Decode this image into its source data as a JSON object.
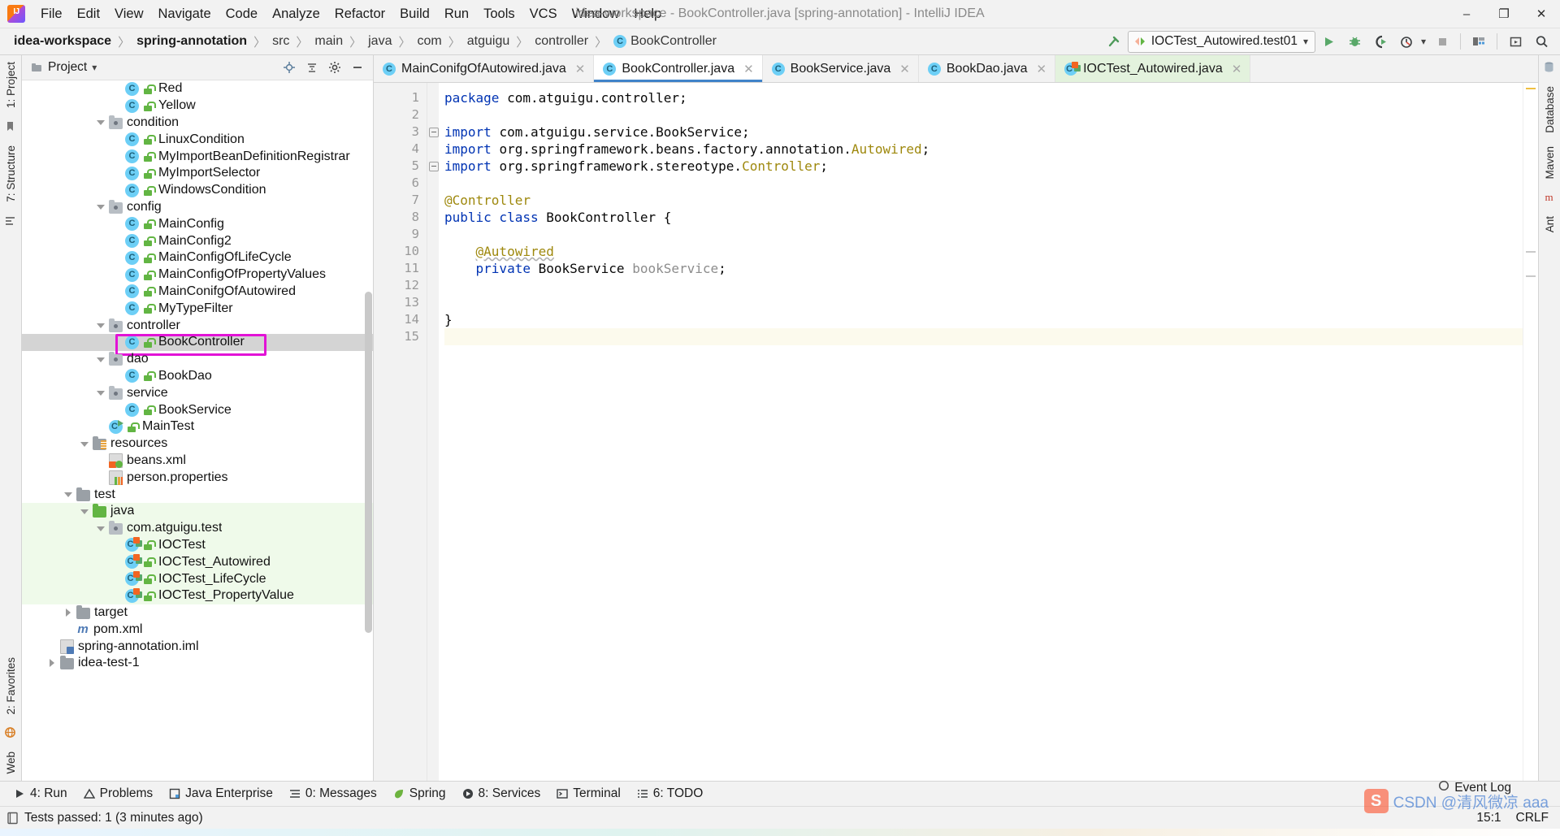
{
  "window": {
    "title": "idea-workspace - BookController.java [spring-annotation] - IntelliJ IDEA",
    "minimize": "–",
    "maximize": "❐",
    "close": "✕"
  },
  "menu": {
    "items": [
      "File",
      "Edit",
      "View",
      "Navigate",
      "Code",
      "Analyze",
      "Refactor",
      "Build",
      "Run",
      "Tools",
      "VCS",
      "Window",
      "Help"
    ]
  },
  "breadcrumb": {
    "items": [
      {
        "label": "idea-workspace",
        "bold": true
      },
      {
        "label": "spring-annotation",
        "bold": true
      },
      {
        "label": "src",
        "bold": false
      },
      {
        "label": "main",
        "bold": false
      },
      {
        "label": "java",
        "bold": false
      },
      {
        "label": "com",
        "bold": false
      },
      {
        "label": "atguigu",
        "bold": false
      },
      {
        "label": "controller",
        "bold": false
      },
      {
        "label": "BookController",
        "bold": false,
        "icon": "class-icon"
      }
    ],
    "separator": "〉"
  },
  "run_toolbar": {
    "config_name": "IOCTest_Autowired.test01",
    "dropdown_caret": "▾",
    "buttons": [
      "run-button",
      "debug-button",
      "run-coverage-button",
      "profile-button",
      "stop-button",
      "build-button",
      "preview-button",
      "search-everywhere-button"
    ],
    "hammer_icon": "build-hammer-icon"
  },
  "project_panel": {
    "title": "Project",
    "title_caret": "▾",
    "actions": [
      "locate-button",
      "collapse-all-button",
      "settings-button",
      "hide-button"
    ],
    "tree": [
      {
        "indent": 5,
        "label": "Red",
        "icon": "class-icon",
        "lock": true
      },
      {
        "indent": 5,
        "label": "Yellow",
        "icon": "class-icon",
        "lock": true
      },
      {
        "indent": 4,
        "label": "condition",
        "icon": "package-icon",
        "arrow": "down"
      },
      {
        "indent": 5,
        "label": "LinuxCondition",
        "icon": "class-icon",
        "lock": true
      },
      {
        "indent": 5,
        "label": "MyImportBeanDefinitionRegistrar",
        "icon": "class-icon",
        "lock": true
      },
      {
        "indent": 5,
        "label": "MyImportSelector",
        "icon": "class-icon",
        "lock": true
      },
      {
        "indent": 5,
        "label": "WindowsCondition",
        "icon": "class-icon",
        "lock": true
      },
      {
        "indent": 4,
        "label": "config",
        "icon": "package-icon",
        "arrow": "down"
      },
      {
        "indent": 5,
        "label": "MainConfig",
        "icon": "class-icon",
        "lock": true
      },
      {
        "indent": 5,
        "label": "MainConfig2",
        "icon": "class-icon",
        "lock": true
      },
      {
        "indent": 5,
        "label": "MainConfigOfLifeCycle",
        "icon": "class-icon",
        "lock": true
      },
      {
        "indent": 5,
        "label": "MainConfigOfPropertyValues",
        "icon": "class-icon",
        "lock": true
      },
      {
        "indent": 5,
        "label": "MainConifgOfAutowired",
        "icon": "class-icon",
        "lock": true
      },
      {
        "indent": 5,
        "label": "MyTypeFilter",
        "icon": "class-icon",
        "lock": true
      },
      {
        "indent": 4,
        "label": "controller",
        "icon": "package-icon",
        "arrow": "down"
      },
      {
        "indent": 5,
        "label": "BookController",
        "icon": "class-icon",
        "lock": true,
        "selected": true,
        "highlight": true
      },
      {
        "indent": 4,
        "label": "dao",
        "icon": "package-icon",
        "arrow": "down"
      },
      {
        "indent": 5,
        "label": "BookDao",
        "icon": "class-icon",
        "lock": true
      },
      {
        "indent": 4,
        "label": "service",
        "icon": "package-icon",
        "arrow": "down"
      },
      {
        "indent": 5,
        "label": "BookService",
        "icon": "class-icon",
        "lock": true
      },
      {
        "indent": 4,
        "label": "MainTest",
        "icon": "runnable-class-icon",
        "lock": true
      },
      {
        "indent": 3,
        "label": "resources",
        "icon": "resource-folder-icon",
        "arrow": "down"
      },
      {
        "indent": 4,
        "label": "beans.xml",
        "icon": "xml-file-icon"
      },
      {
        "indent": 4,
        "label": "person.properties",
        "icon": "properties-file-icon"
      },
      {
        "indent": 2,
        "label": "test",
        "icon": "folder-icon",
        "arrow": "down"
      },
      {
        "indent": 3,
        "label": "java",
        "icon": "test-source-folder-icon",
        "arrow": "down",
        "testbg": true
      },
      {
        "indent": 4,
        "label": "com.atguigu.test",
        "icon": "package-icon",
        "arrow": "down",
        "testbg": true
      },
      {
        "indent": 5,
        "label": "IOCTest",
        "icon": "test-class-icon",
        "lock": true,
        "testbg": true
      },
      {
        "indent": 5,
        "label": "IOCTest_Autowired",
        "icon": "test-class-icon",
        "lock": true,
        "testbg": true
      },
      {
        "indent": 5,
        "label": "IOCTest_LifeCycle",
        "icon": "test-class-icon",
        "lock": true,
        "testbg": true
      },
      {
        "indent": 5,
        "label": "IOCTest_PropertyValue",
        "icon": "test-class-icon",
        "lock": true,
        "testbg": true
      },
      {
        "indent": 2,
        "label": "target",
        "icon": "folder-icon",
        "arrow": "right"
      },
      {
        "indent": 2,
        "label": "pom.xml",
        "icon": "maven-icon"
      },
      {
        "indent": 1,
        "label": "spring-annotation.iml",
        "icon": "iml-file-icon"
      },
      {
        "indent": 1,
        "label": "idea-test-1",
        "icon": "folder-icon",
        "arrow": "right",
        "clipped": true
      }
    ]
  },
  "left_strip": {
    "tabs": [
      "1: Project",
      "7: Structure",
      "2: Favorites",
      "Web"
    ]
  },
  "right_strip": {
    "tabs": [
      "Database",
      "Maven",
      "Ant"
    ]
  },
  "editor": {
    "tabs": [
      {
        "label": "MainConifgOfAutowired.java",
        "icon": "java-class-icon",
        "active": false,
        "test": false
      },
      {
        "label": "BookController.java",
        "icon": "java-class-icon",
        "active": true,
        "test": false
      },
      {
        "label": "BookService.java",
        "icon": "java-class-icon",
        "active": false,
        "test": false
      },
      {
        "label": "BookDao.java",
        "icon": "java-class-icon",
        "active": false,
        "test": false
      },
      {
        "label": "IOCTest_Autowired.java",
        "icon": "java-test-class-icon",
        "active": false,
        "test": true
      }
    ],
    "close_glyph": "✕",
    "lines": [
      {
        "n": 1,
        "fold": false,
        "current": false,
        "tokens": [
          {
            "t": "package ",
            "c": "k"
          },
          {
            "t": "com.atguigu.controller;",
            "c": "pln"
          }
        ]
      },
      {
        "n": 2,
        "fold": false,
        "current": false,
        "tokens": []
      },
      {
        "n": 3,
        "fold": true,
        "current": false,
        "tokens": [
          {
            "t": "import ",
            "c": "k"
          },
          {
            "t": "com.atguigu.service.BookService;",
            "c": "pln"
          }
        ]
      },
      {
        "n": 4,
        "fold": false,
        "current": false,
        "tokens": [
          {
            "t": "import ",
            "c": "k"
          },
          {
            "t": "org.springframework.beans.factory.annotation.",
            "c": "pln"
          },
          {
            "t": "Autowired",
            "c": "ann"
          },
          {
            "t": ";",
            "c": "pln"
          }
        ]
      },
      {
        "n": 5,
        "fold": true,
        "current": false,
        "tokens": [
          {
            "t": "import ",
            "c": "k"
          },
          {
            "t": "org.springframework.stereotype.",
            "c": "pln"
          },
          {
            "t": "Controller",
            "c": "ann"
          },
          {
            "t": ";",
            "c": "pln"
          }
        ]
      },
      {
        "n": 6,
        "fold": false,
        "current": false,
        "tokens": []
      },
      {
        "n": 7,
        "fold": false,
        "current": false,
        "tokens": [
          {
            "t": "@Controller",
            "c": "ann"
          }
        ]
      },
      {
        "n": 8,
        "fold": false,
        "current": false,
        "tokens": [
          {
            "t": "public class ",
            "c": "k"
          },
          {
            "t": "BookController {",
            "c": "pln"
          }
        ]
      },
      {
        "n": 9,
        "fold": false,
        "current": false,
        "tokens": []
      },
      {
        "n": 10,
        "fold": false,
        "current": false,
        "tokens": [
          {
            "t": "    ",
            "c": "pln"
          },
          {
            "t": "@Autowired",
            "c": "ann warn"
          }
        ]
      },
      {
        "n": 11,
        "fold": false,
        "current": false,
        "tokens": [
          {
            "t": "    ",
            "c": "pln"
          },
          {
            "t": "private ",
            "c": "k"
          },
          {
            "t": "BookService ",
            "c": "pln"
          },
          {
            "t": "bookService",
            "c": "var"
          },
          {
            "t": ";",
            "c": "pln"
          }
        ]
      },
      {
        "n": 12,
        "fold": false,
        "current": false,
        "tokens": []
      },
      {
        "n": 13,
        "fold": false,
        "current": false,
        "tokens": []
      },
      {
        "n": 14,
        "fold": false,
        "current": false,
        "tokens": [
          {
            "t": "}",
            "c": "pln"
          }
        ]
      },
      {
        "n": 15,
        "fold": false,
        "current": true,
        "tokens": []
      }
    ]
  },
  "bottom_tools": [
    {
      "label": "4: Run",
      "icon": "run-icon"
    },
    {
      "label": "Problems",
      "icon": "problems-icon"
    },
    {
      "label": "Java Enterprise",
      "icon": "java-enterprise-icon"
    },
    {
      "label": "0: Messages",
      "icon": "messages-icon"
    },
    {
      "label": "Spring",
      "icon": "spring-leaf-icon"
    },
    {
      "label": "8: Services",
      "icon": "services-icon"
    },
    {
      "label": "Terminal",
      "icon": "terminal-icon"
    },
    {
      "label": "6: TODO",
      "icon": "todo-icon"
    }
  ],
  "status": {
    "message": "Tests passed: 1 (3 minutes ago)",
    "message_icon": "test-result-icon",
    "event_log": "Event Log",
    "event_log_icon": "event-log-icon",
    "caret_position": "15:1",
    "line_separator": "CRLF"
  },
  "watermark": {
    "brand": "S",
    "text": "CSDN @清风微凉 aaa"
  },
  "colors": {
    "accent": "#4083c9",
    "highlight_box": "#e213d6",
    "test_bg": "#effaea",
    "selection": "#d4d4d4",
    "keyword": "#0033b3",
    "annotation": "#9e880d",
    "field": "#8c8c8c",
    "green": "#59a869"
  }
}
